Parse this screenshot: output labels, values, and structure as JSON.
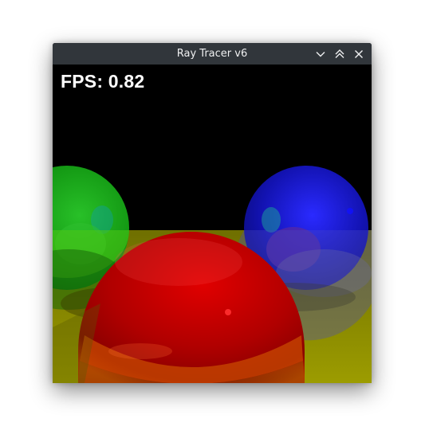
{
  "window": {
    "title": "Ray Tracer v6",
    "controls": {
      "minimize_icon": "chevron-down-icon",
      "maximize_icon": "double-chevron-up-icon",
      "close_icon": "close-icon"
    }
  },
  "viewport": {
    "fps_text": "FPS: 0.82"
  },
  "colors": {
    "titlebar": "#31363b",
    "title_text": "#eff0f1",
    "floor": "#8a8a00",
    "sphere_red": "#c00000",
    "sphere_green": "#16a016",
    "sphere_blue": "#1a1ac8"
  }
}
